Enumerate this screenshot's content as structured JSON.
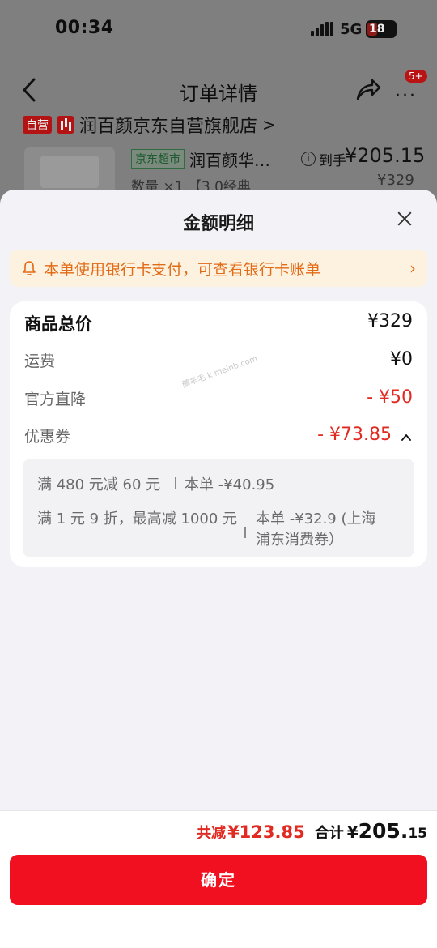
{
  "status_bar": {
    "time": "00:34",
    "network": "5G",
    "battery": "18"
  },
  "nav": {
    "title": "订单详情",
    "badge": "5+"
  },
  "shop": {
    "self_tag": "自营",
    "name": "润百颜京东自营旗舰店",
    "arrow": ">"
  },
  "product": {
    "supermarket_tag": "京东超市",
    "name": "润百颜华…",
    "qty": "数量 ×1,【3.0经典",
    "arrive_label": "到手",
    "arrive_price": "¥205.15",
    "original_price": "¥329"
  },
  "sheet": {
    "title": "金额明细",
    "notice": "本单使用银行卡支付，可查看银行卡账单",
    "rows": [
      {
        "label": "商品总价",
        "value": "¥329"
      },
      {
        "label": "运费",
        "value": "¥0"
      },
      {
        "label": "官方直降",
        "value": "- ¥50"
      },
      {
        "label": "优惠券",
        "value": "- ¥73.85"
      }
    ],
    "watermark": "薅羊毛 k.meinb.com",
    "coupons": [
      {
        "rule": "满 480 元减 60 元",
        "detail": "本单 -¥40.95"
      },
      {
        "rule": "满 1 元 9 折，最高减 1000 元",
        "detail_line1": "本单 -¥32.9 (上海",
        "detail_line2": "浦东消费券）"
      }
    ]
  },
  "footer": {
    "saved_label": "共减",
    "saved_value": "¥123.85",
    "sum_label": "合计",
    "sum_currency": "¥",
    "sum_int": "205.",
    "sum_dec": "15",
    "confirm_label": "确定"
  },
  "colors": {
    "accent_red": "#e02a22",
    "button_red": "#f0101f",
    "notice_orange": "#e26b17"
  }
}
